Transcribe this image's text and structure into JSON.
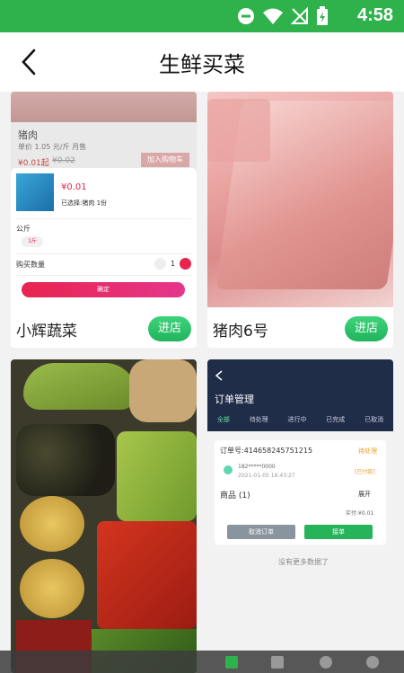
{
  "status": {
    "time": "4:58"
  },
  "nav": {
    "title": "生鲜买菜"
  },
  "cards": [
    {
      "name": "小辉蔬菜",
      "button": "进店",
      "inner": {
        "top_title": "猪肉",
        "top_sub": "单价 1.05 元/斤 月售",
        "top_price": "¥0.01起",
        "top_old": "¥0.02",
        "top_btn": "加入购物车",
        "sheet_price": "¥0.01",
        "sheet_selected": "已选择:猪肉 1份",
        "spec_label": "公斤",
        "spec_chip": "1斤",
        "qty_label": "购买数量",
        "qty_value": "1",
        "confirm": "确定"
      }
    },
    {
      "name": "猪肉6号",
      "button": "进店"
    },
    {},
    {
      "inner": {
        "header": "订单管理",
        "tabs": [
          "全部",
          "待处理",
          "进行中",
          "已完成",
          "已取消"
        ],
        "order_no": "订单号:414658245751215",
        "order_status": "待处理",
        "phone": "182*****0000",
        "date": "2021-01-05 16:43:27",
        "tag": "[已付款]",
        "goods_label": "商品 (1)",
        "goods_more": "展开",
        "total": "实付:¥0.01",
        "btn_left": "取消订单",
        "btn_right": "接单",
        "footer": "没有更多数据了"
      }
    }
  ],
  "colors": {
    "brand": "#2fb24c",
    "accent": "#e8244f"
  }
}
